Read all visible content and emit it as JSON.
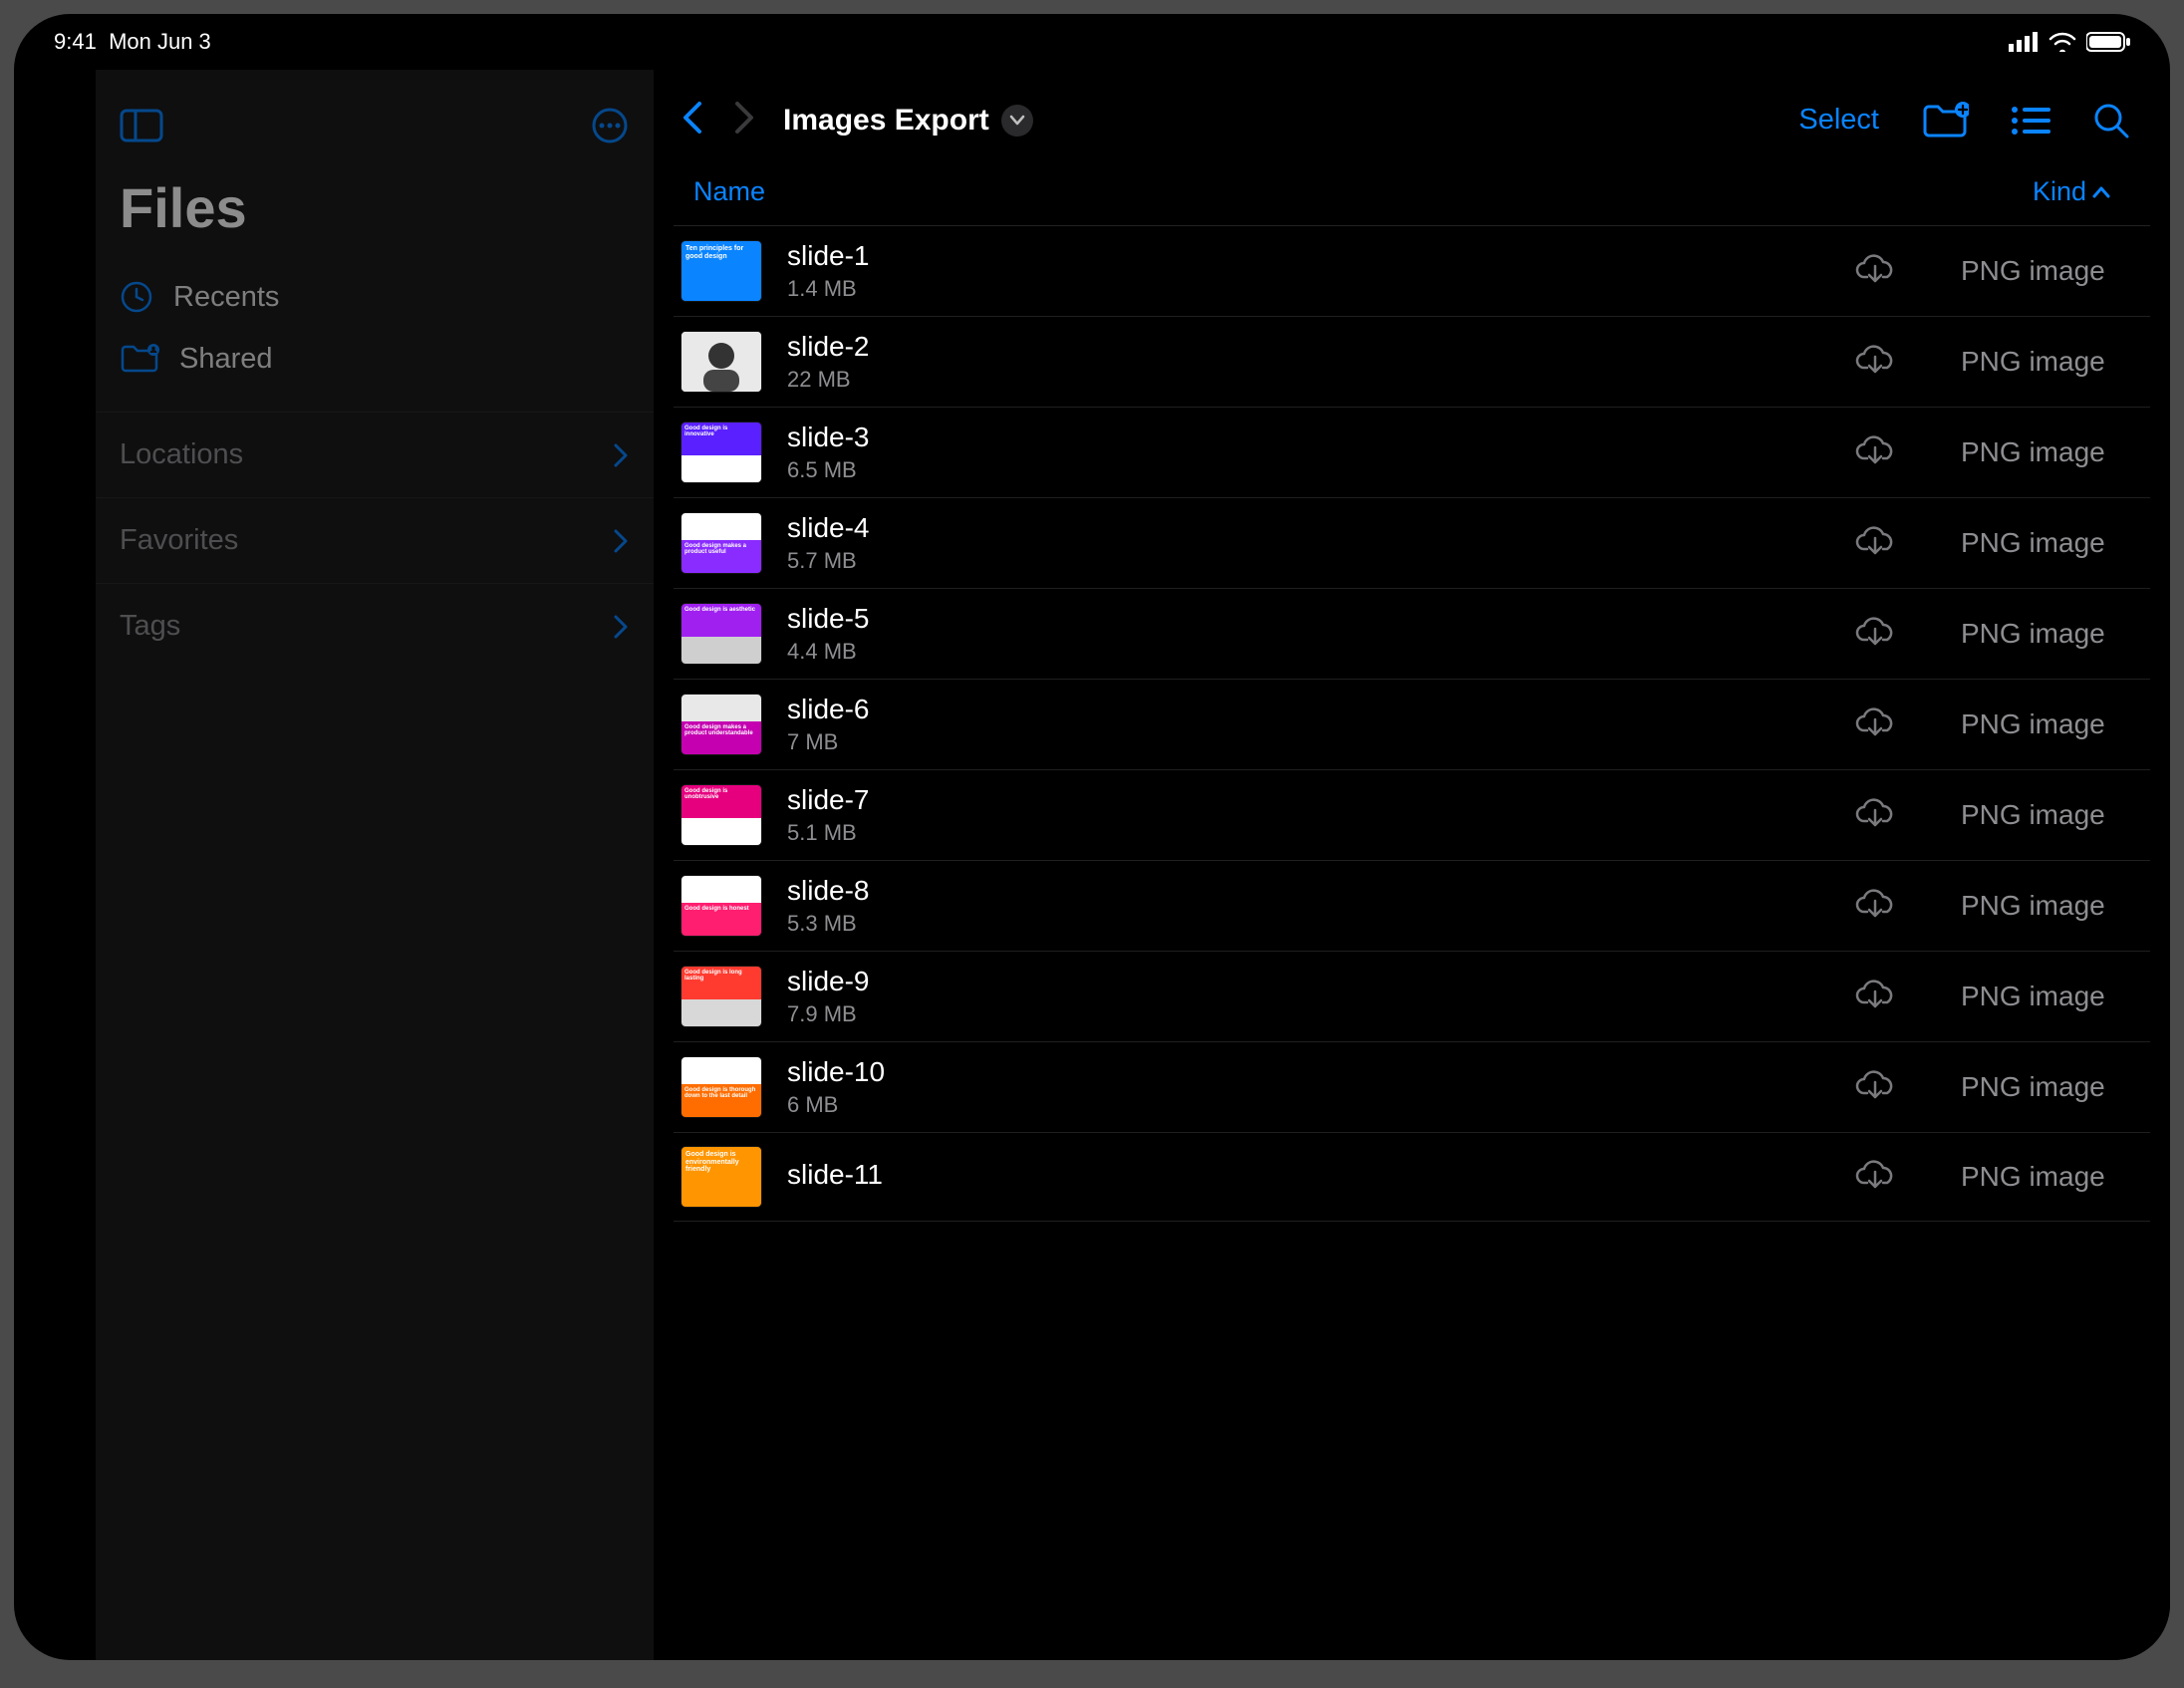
{
  "statusbar": {
    "time": "9:41",
    "date": "Mon Jun 3"
  },
  "sidebar": {
    "title": "Files",
    "recents": "Recents",
    "shared": "Shared",
    "sections": {
      "locations": "Locations",
      "favorites": "Favorites",
      "tags": "Tags"
    }
  },
  "navbar": {
    "title": "Images Export",
    "select": "Select"
  },
  "list": {
    "columns": {
      "name": "Name",
      "kind": "Kind"
    },
    "items": [
      {
        "name": "slide-1",
        "size": "1.4 MB",
        "kind": "PNG image",
        "thumb": {
          "type": "solid",
          "a": "#0a84ff",
          "label": "Ten principles for good design"
        }
      },
      {
        "name": "slide-2",
        "size": "22 MB",
        "kind": "PNG image",
        "thumb": {
          "type": "portrait"
        }
      },
      {
        "name": "slide-3",
        "size": "6.5 MB",
        "kind": "PNG image",
        "thumb": {
          "type": "split",
          "a": "#5a20ff",
          "b": "#ffffff",
          "label": "Good design is innovative"
        }
      },
      {
        "name": "slide-4",
        "size": "5.7 MB",
        "kind": "PNG image",
        "thumb": {
          "type": "split-bottom",
          "a": "#ffffff",
          "b": "#8a2bff",
          "label": "Good design makes a product useful"
        }
      },
      {
        "name": "slide-5",
        "size": "4.4 MB",
        "kind": "PNG image",
        "thumb": {
          "type": "split",
          "a": "#a020f0",
          "b": "#cfcfcf",
          "label": "Good design is aesthetic"
        }
      },
      {
        "name": "slide-6",
        "size": "7 MB",
        "kind": "PNG image",
        "thumb": {
          "type": "split-bottom",
          "a": "#e8e8e8",
          "b": "#c400b0",
          "label": "Good design makes a product understandable"
        }
      },
      {
        "name": "slide-7",
        "size": "5.1 MB",
        "kind": "PNG image",
        "thumb": {
          "type": "split",
          "a": "#e6007e",
          "b": "#ffffff",
          "label": "Good design is unobtrusive"
        }
      },
      {
        "name": "slide-8",
        "size": "5.3 MB",
        "kind": "PNG image",
        "thumb": {
          "type": "split-bottom",
          "a": "#ffffff",
          "b": "#ff1e70",
          "label": "Good design is honest"
        }
      },
      {
        "name": "slide-9",
        "size": "7.9 MB",
        "kind": "PNG image",
        "thumb": {
          "type": "split",
          "a": "#ff3b30",
          "b": "#d8d8d8",
          "label": "Good design is long lasting"
        }
      },
      {
        "name": "slide-10",
        "size": "6 MB",
        "kind": "PNG image",
        "thumb": {
          "type": "split-bottom",
          "a": "#ffffff",
          "b": "#ff6d00",
          "label": "Good design is thorough down to the last detail"
        }
      },
      {
        "name": "slide-11",
        "size": "",
        "kind": "PNG image",
        "thumb": {
          "type": "solid",
          "a": "#ff9500",
          "label": "Good design is environmentally friendly"
        }
      }
    ]
  }
}
